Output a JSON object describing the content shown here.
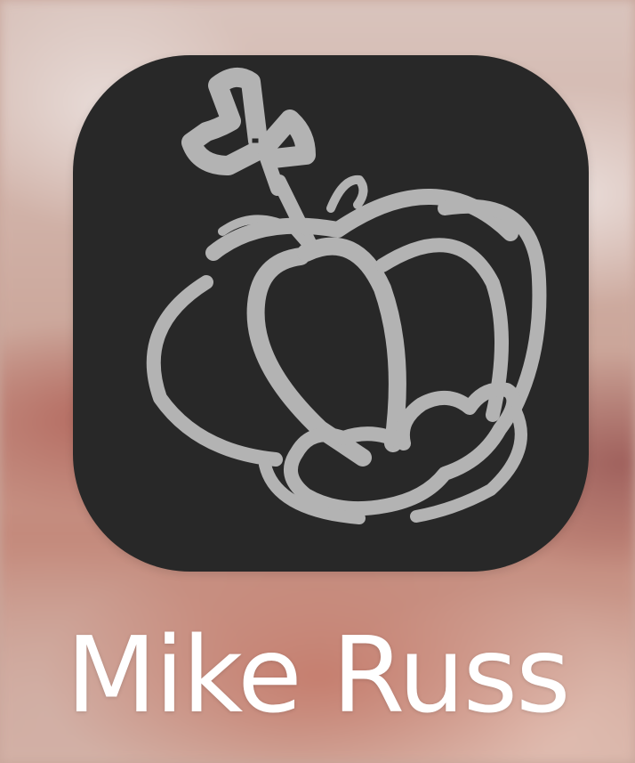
{
  "home_screen": {
    "app": {
      "name": "Mike Russ",
      "icon": "crown-icon",
      "icon_background": "#282828",
      "icon_glyph_color": "#b3b3b3",
      "label_color": "#ffffff"
    }
  }
}
